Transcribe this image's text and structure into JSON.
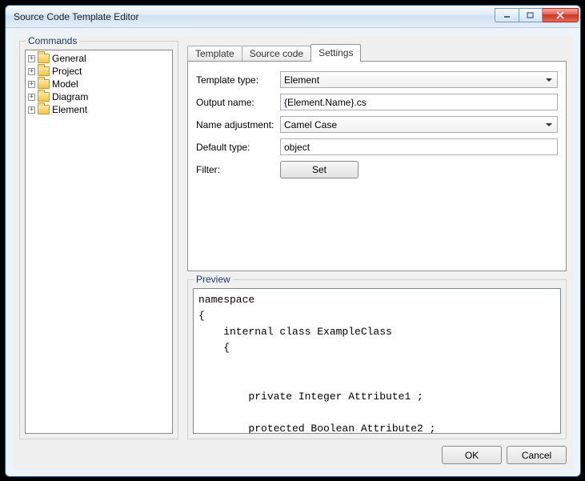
{
  "window": {
    "title": "Source Code Template Editor"
  },
  "commands": {
    "group_label": "Commands",
    "items": [
      {
        "label": "General"
      },
      {
        "label": "Project"
      },
      {
        "label": "Model"
      },
      {
        "label": "Diagram"
      },
      {
        "label": "Element"
      }
    ]
  },
  "tabs": {
    "template": "Template",
    "source_code": "Source code",
    "settings": "Settings",
    "active": "settings"
  },
  "settings": {
    "template_type_label": "Template type:",
    "template_type_value": "Element",
    "output_name_label": "Output name:",
    "output_name_value": "{Element.Name}.cs",
    "name_adjustment_label": "Name adjustment:",
    "name_adjustment_value": "Camel Case",
    "default_type_label": "Default type:",
    "default_type_value": "object",
    "filter_label": "Filter:",
    "filter_button": "Set"
  },
  "preview": {
    "group_label": "Preview",
    "code": "namespace\n{\n    internal class ExampleClass\n    {\n\n\n        private Integer Attribute1 ;\n\n        protected Boolean Attribute2 ;\n"
  },
  "buttons": {
    "ok": "OK",
    "cancel": "Cancel"
  }
}
